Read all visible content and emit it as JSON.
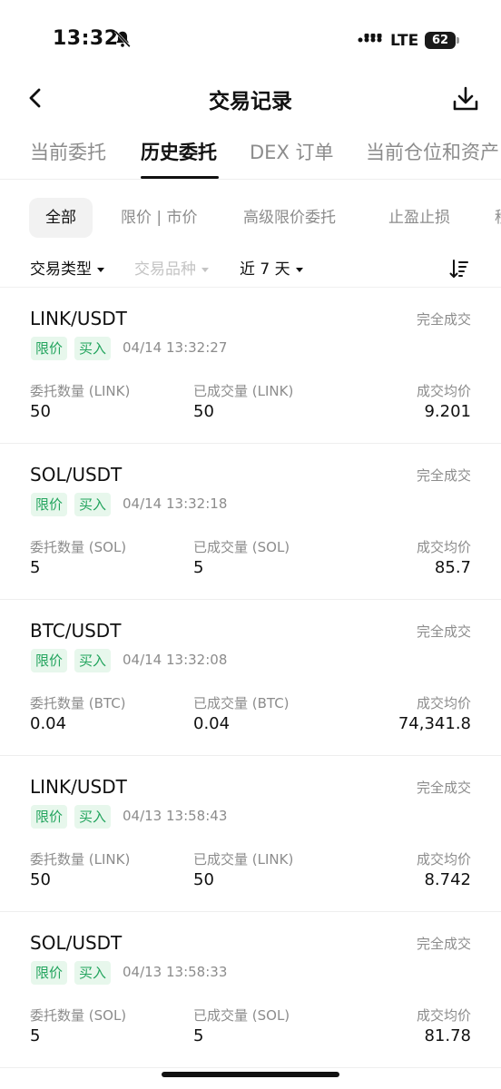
{
  "status_bar": {
    "time": "13:32",
    "network": "LTE",
    "battery": "62"
  },
  "header": {
    "title": "交易记录"
  },
  "main_tabs": [
    {
      "label": "当前委托"
    },
    {
      "label": "历史委托"
    },
    {
      "label": "DEX 订单"
    },
    {
      "label": "当前仓位和资产"
    }
  ],
  "chips": [
    {
      "label": "全部"
    },
    {
      "label": "限价 | 市价"
    },
    {
      "label": "高级限价委托"
    },
    {
      "label": "止盈止损"
    },
    {
      "label": "移"
    }
  ],
  "filters": {
    "trade_type": "交易类型",
    "instrument": "交易品种",
    "period": "近 7 天"
  },
  "orders": [
    {
      "pair": "LINK/USDT",
      "status": "完全成交",
      "type": "限价",
      "side": "买入",
      "time": "04/14 13:32:27",
      "qty_label": "委托数量 (LINK)",
      "qty": "50",
      "filled_label": "已成交量 (LINK)",
      "filled": "50",
      "avg_label": "成交均价",
      "avg": "9.201"
    },
    {
      "pair": "SOL/USDT",
      "status": "完全成交",
      "type": "限价",
      "side": "买入",
      "time": "04/14 13:32:18",
      "qty_label": "委托数量 (SOL)",
      "qty": "5",
      "filled_label": "已成交量 (SOL)",
      "filled": "5",
      "avg_label": "成交均价",
      "avg": "85.7"
    },
    {
      "pair": "BTC/USDT",
      "status": "完全成交",
      "type": "限价",
      "side": "买入",
      "time": "04/14 13:32:08",
      "qty_label": "委托数量 (BTC)",
      "qty": "0.04",
      "filled_label": "已成交量 (BTC)",
      "filled": "0.04",
      "avg_label": "成交均价",
      "avg": "74,341.8"
    },
    {
      "pair": "LINK/USDT",
      "status": "完全成交",
      "type": "限价",
      "side": "买入",
      "time": "04/13 13:58:43",
      "qty_label": "委托数量 (LINK)",
      "qty": "50",
      "filled_label": "已成交量 (LINK)",
      "filled": "50",
      "avg_label": "成交均价",
      "avg": "8.742"
    },
    {
      "pair": "SOL/USDT",
      "status": "完全成交",
      "type": "限价",
      "side": "买入",
      "time": "04/13 13:58:33",
      "qty_label": "委托数量 (SOL)",
      "qty": "5",
      "filled_label": "已成交量 (SOL)",
      "filled": "5",
      "avg_label": "成交均价",
      "avg": "81.78"
    }
  ],
  "colors": {
    "tag_text": "#22a45d",
    "tag_bg": "#e7f7ec",
    "muted": "#8c8c8c"
  },
  "icons": [
    "bell-mute-icon",
    "signal-icon",
    "battery-icon",
    "back-arrow-icon",
    "download-icon",
    "caret-down-icon",
    "sort-icon"
  ]
}
